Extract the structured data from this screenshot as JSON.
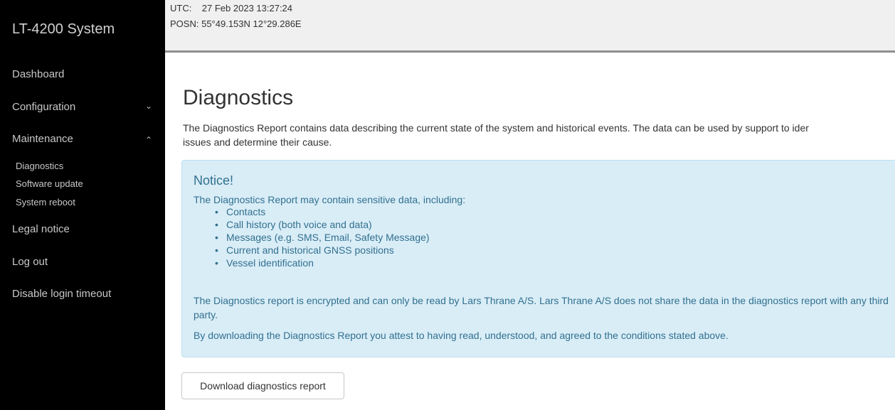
{
  "sidebar": {
    "brand": "LT-4200 System",
    "items": [
      {
        "label": "Dashboard"
      },
      {
        "label": "Configuration",
        "chevron": "chevron-down-icon"
      },
      {
        "label": "Maintenance",
        "chevron": "chevron-up-icon"
      },
      {
        "label": "Legal notice"
      },
      {
        "label": "Log out"
      },
      {
        "label": "Disable login timeout"
      }
    ],
    "maintenance_sub": [
      {
        "label": "Diagnostics"
      },
      {
        "label": "Software update"
      },
      {
        "label": "System reboot"
      }
    ]
  },
  "topbar": {
    "utc_label": "UTC:",
    "utc_value": "27 Feb 2023 13:27:24",
    "posn_label": "POSN:",
    "posn_value": "55°49.153N 12°29.286E"
  },
  "page": {
    "title": "Diagnostics",
    "intro_line1": "The Diagnostics Report contains data describing the current state of the system and historical events. The data can be used by support to ider",
    "intro_line2": "issues and determine their cause."
  },
  "notice": {
    "title": "Notice!",
    "desc": "The Diagnostics Report may contain sensitive data, including:",
    "items": [
      "Contacts",
      "Call history (both voice and data)",
      "Messages (e.g. SMS, Email, Safety Message)",
      "Current and historical GNSS positions",
      "Vessel identification"
    ],
    "p1": "The Diagnostics report is encrypted and can only be read by Lars Thrane A/S. Lars Thrane A/S does not share the data in the diagnostics report with any third party.",
    "p2": "By downloading the Diagnostics Report you attest to having read, understood, and agreed to the conditions stated above."
  },
  "download_button": "Download diagnostics report",
  "colors": {
    "sidebar_bg": "#000000",
    "notice_bg": "#d9edf7",
    "notice_text": "#31708f",
    "topbar_bg": "#f0f0f0"
  }
}
